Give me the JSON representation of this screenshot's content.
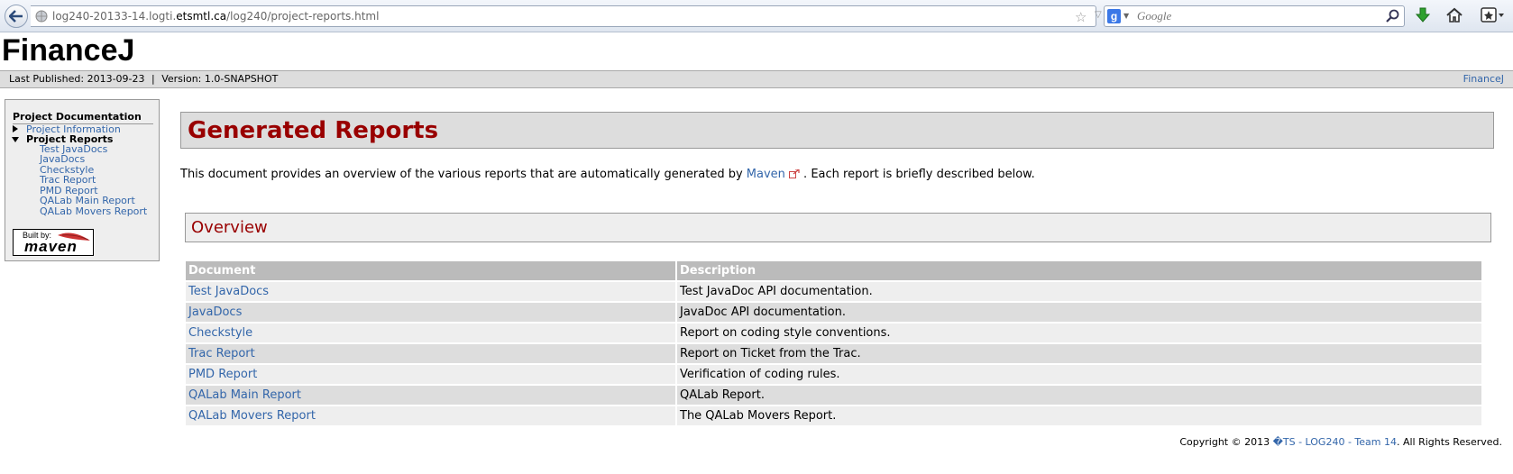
{
  "browser": {
    "url_prefix": "log240-20133-14.logti.",
    "url_domain": "etsmtl.ca",
    "url_path": "/log240/project-reports.html",
    "search_placeholder": "Google"
  },
  "banner": {
    "title": "FinanceJ"
  },
  "breadcrumbs": {
    "published": "Last Published: 2013-09-23",
    "separator": "|",
    "version": "Version: 1.0-SNAPSHOT",
    "right_link": "FinanceJ"
  },
  "sidebar": {
    "heading": "Project Documentation",
    "items": [
      {
        "label": "Project Information"
      },
      {
        "label": "Project Reports"
      },
      {
        "label": "Test JavaDocs"
      },
      {
        "label": "JavaDocs"
      },
      {
        "label": "Checkstyle"
      },
      {
        "label": "Trac Report"
      },
      {
        "label": "PMD Report"
      },
      {
        "label": "QALab Main Report"
      },
      {
        "label": "QALab Movers Report"
      }
    ],
    "built_by": "Built by:",
    "maven_logo_text": "maven"
  },
  "main": {
    "title": "Generated Reports",
    "intro_before": "This document provides an overview of the various reports that are automatically generated by ",
    "intro_link": "Maven",
    "intro_after": " . Each report is briefly described below.",
    "section_title": "Overview",
    "table": {
      "headers": [
        "Document",
        "Description"
      ],
      "rows": [
        {
          "document": "Test JavaDocs",
          "description": "Test JavaDoc API documentation."
        },
        {
          "document": "JavaDocs",
          "description": "JavaDoc API documentation."
        },
        {
          "document": "Checkstyle",
          "description": "Report on coding style conventions."
        },
        {
          "document": "Trac Report",
          "description": "Report on Ticket from the Trac."
        },
        {
          "document": "PMD Report",
          "description": "Verification of coding rules."
        },
        {
          "document": "QALab Main Report",
          "description": "QALab Report."
        },
        {
          "document": "QALab Movers Report",
          "description": "The QALab Movers Report."
        }
      ]
    }
  },
  "footer": {
    "copyright": "Copyright © 2013 ",
    "link": "�TS - LOG240 - Team 14",
    "rights": ". All Rights Reserved."
  },
  "colors": {
    "heading_red": "#990000",
    "link_blue": "#3366aa",
    "header_gray": "#bbbbbb"
  }
}
